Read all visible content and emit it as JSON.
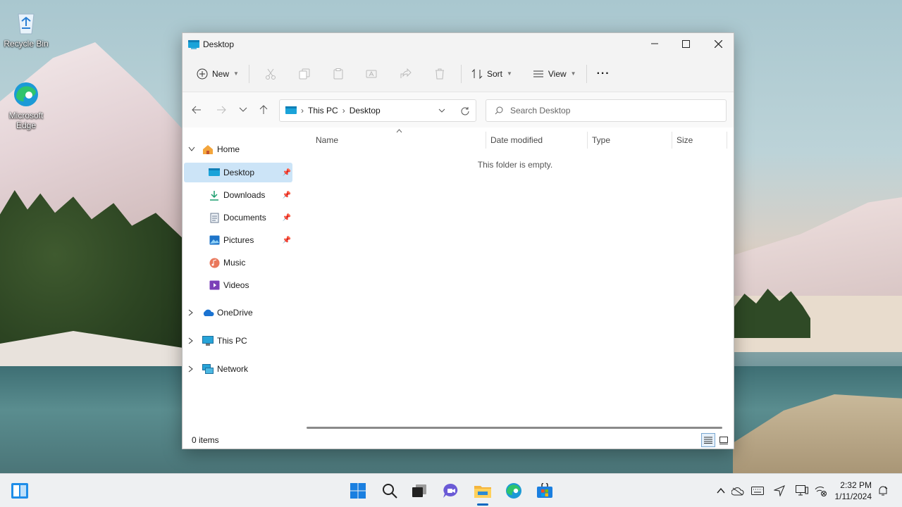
{
  "desktop": {
    "icons": [
      {
        "label": "Recycle Bin",
        "icon": "recycle-bin-icon"
      },
      {
        "label": "Microsoft Edge",
        "icon": "edge-icon"
      }
    ]
  },
  "window": {
    "title": "Desktop",
    "controls": [
      "minimize-icon",
      "maximize-icon",
      "close-icon"
    ]
  },
  "commandbar": {
    "new_label": "New",
    "sort_label": "Sort",
    "view_label": "View",
    "more_label": "···",
    "icons": [
      "cut-icon",
      "copy-icon",
      "paste-icon",
      "rename-icon",
      "share-icon",
      "delete-icon"
    ]
  },
  "navigation": {
    "breadcrumb": [
      "This PC",
      "Desktop"
    ],
    "search_placeholder": "Search Desktop"
  },
  "sidebar": {
    "home": "Home",
    "quick_access": [
      {
        "label": "Desktop",
        "pinned": true,
        "selected": true
      },
      {
        "label": "Downloads",
        "pinned": true
      },
      {
        "label": "Documents",
        "pinned": true
      },
      {
        "label": "Pictures",
        "pinned": true
      },
      {
        "label": "Music",
        "pinned": false
      },
      {
        "label": "Videos",
        "pinned": false
      }
    ],
    "roots": [
      "OneDrive",
      "This PC",
      "Network"
    ]
  },
  "content": {
    "columns": [
      "Name",
      "Date modified",
      "Type",
      "Size"
    ],
    "empty_message": "This folder is empty."
  },
  "status": {
    "item_count": "0 items"
  },
  "taskbar": {
    "apps": [
      "start-icon",
      "search-icon",
      "task-view-icon",
      "chat-icon",
      "file-explorer-icon",
      "edge-icon",
      "store-icon"
    ],
    "tray": [
      "chevron-up-icon",
      "onedrive-icon",
      "keyboard-icon",
      "location-icon",
      "display-icon",
      "network-icon"
    ],
    "time": "2:32 PM",
    "date": "1/11/2024"
  },
  "colors": {
    "accent": "#0067c0",
    "selection": "#cce4f7",
    "window_bg": "#ffffff",
    "chrome_bg": "#f3f3f3"
  }
}
